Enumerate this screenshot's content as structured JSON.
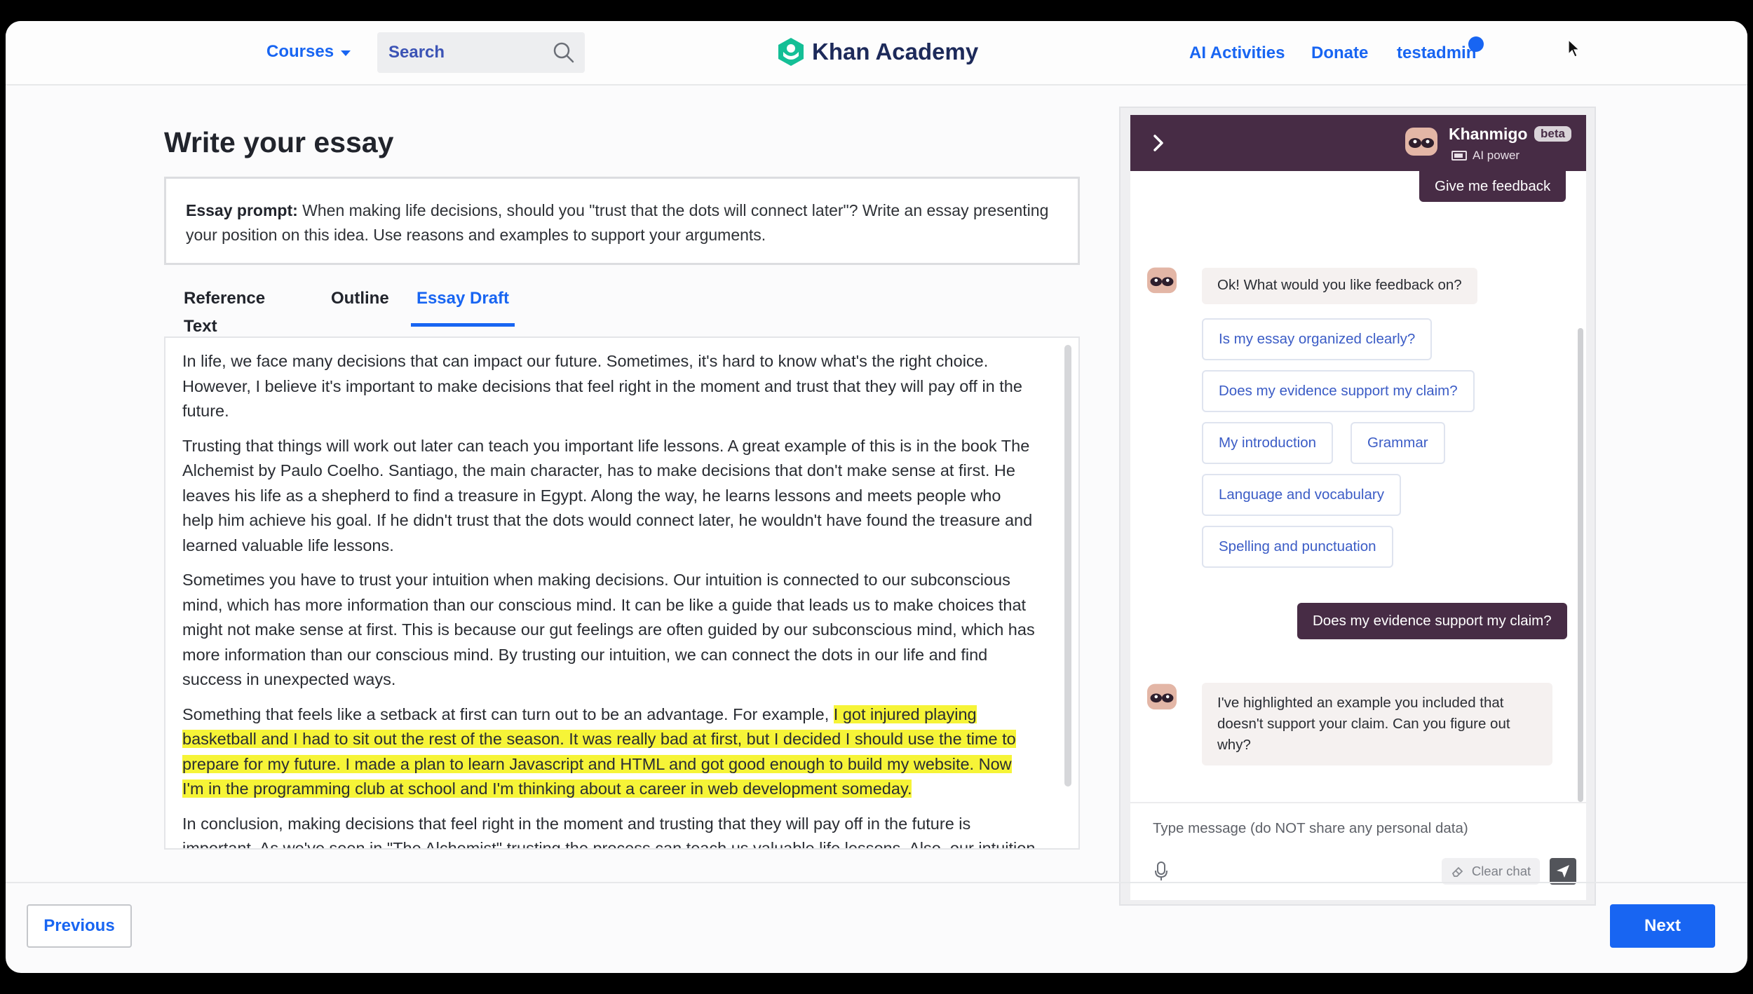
{
  "header": {
    "courses_label": "Courses",
    "search_placeholder": "Search",
    "logo_text": "Khan Academy",
    "ai_activities_label": "AI Activities",
    "donate_label": "Donate",
    "user_label": "testadmin",
    "accent_color": "#1865f2"
  },
  "main": {
    "title": "Write your essay",
    "prompt_label": "Essay prompt:",
    "prompt_text": " When making life decisions, should you \"trust that the dots will connect later\"? Write an essay presenting your position on this idea. Use reasons and examples to support your arguments.",
    "tabs": [
      {
        "label": "Reference Text",
        "active": false
      },
      {
        "label": "Outline",
        "active": false
      },
      {
        "label": "Essay Draft",
        "active": true
      }
    ],
    "essay": {
      "p1": "In life, we face many decisions that can impact our future. Sometimes, it's hard to know what's the right choice. However, I believe it's important to make decisions that feel right in the moment and trust that they will pay off in the future.",
      "p2": "Trusting that things will work out later can teach you important life lessons. A great example of this is in the book The Alchemist by Paulo Coelho. Santiago, the main character, has to make decisions that don't make sense at first. He leaves his life as a shepherd to find a treasure in Egypt. Along the way, he learns lessons and meets people who help him achieve his goal. If he didn't trust that the dots would connect later, he wouldn't have found the treasure and learned valuable life lessons.",
      "p3": "Sometimes you have to trust your intuition when making decisions. Our intuition is connected to our subconscious mind, which has more information than our conscious mind. It can be like a guide that leads us to make choices that might not make sense at first. This is because our gut feelings are often guided by our subconscious mind, which has more information than our conscious mind. By trusting our intuition, we can connect the dots in our life and find success in unexpected ways.",
      "p4_plain": "Something that feels like a setback at first can turn out to be an advantage. For example, ",
      "p4_highlight": "I got injured playing basketball and I had to sit out the rest of the season. It was really bad at first, but I decided I should use the time to prepare for my future. I made a plan to learn Javascript and HTML and got good enough to build my website. Now I'm in the programming club at school and I'm thinking about a career in web development someday.",
      "p5": "In conclusion, making decisions that feel right in the moment and trusting that they will pay off in the future is important. As we've seen in \"The Alchemist\" trusting the process can teach us valuable life lessons. Also, our intuition",
      "highlight_color": "#f6f437"
    }
  },
  "khanmigo": {
    "name": "Khanmigo",
    "badge": "beta",
    "ai_power_label": "AI power",
    "header_color": "#472c45",
    "user_msg_1": "Give me feedback",
    "bot_msg_1": "Ok! What would you like feedback on?",
    "chips": [
      "Is my essay organized clearly?",
      "Does my evidence support my claim?",
      "My introduction",
      "Grammar",
      "Language and vocabulary",
      "Spelling and punctuation"
    ],
    "user_msg_2": "Does my evidence support my claim?",
    "bot_msg_2": "I've highlighted an example you included that doesn't support your claim. Can you figure out why?",
    "composer_placeholder": "Type message (do NOT share any personal data)",
    "clear_chat_label": "Clear chat"
  },
  "footer": {
    "previous_label": "Previous",
    "next_label": "Next"
  }
}
